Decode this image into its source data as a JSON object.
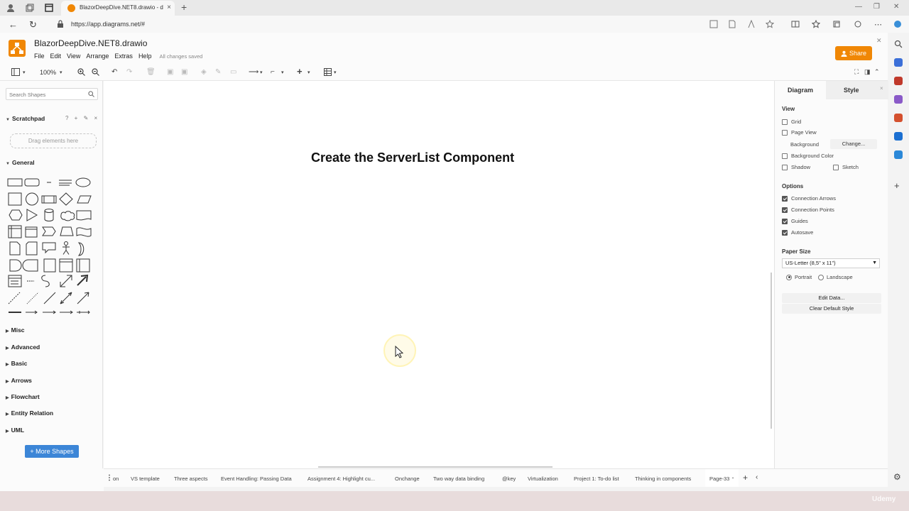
{
  "browser": {
    "tab_title": "BlazorDeepDive.NET8.drawio - d",
    "url": "https://app.diagrams.net/#",
    "new_tab": "+",
    "tab_close": "×"
  },
  "app": {
    "file_title": "BlazorDeepDive.NET8.drawio",
    "menu": [
      "File",
      "Edit",
      "View",
      "Arrange",
      "Extras",
      "Help"
    ],
    "save_status": "All changes saved",
    "share_label": "Share",
    "zoom": "100%"
  },
  "left_panel": {
    "search_placeholder": "Search Shapes",
    "scratchpad": "Scratchpad",
    "scratchpad_controls": "? + ✎ ×",
    "drop_hint": "Drag elements here",
    "general": "General",
    "categories": [
      "Misc",
      "Advanced",
      "Basic",
      "Arrows",
      "Flowchart",
      "Entity Relation",
      "UML"
    ],
    "more_shapes": "+ More Shapes"
  },
  "canvas": {
    "diagram_text": "Create the ServerList Component"
  },
  "right_panel": {
    "tab_diagram": "Diagram",
    "tab_style": "Style",
    "view_heading": "View",
    "grid": "Grid",
    "page_view": "Page View",
    "background": "Background",
    "change_btn": "Change...",
    "background_color": "Background Color",
    "shadow": "Shadow",
    "sketch": "Sketch",
    "options_heading": "Options",
    "connection_arrows": "Connection Arrows",
    "connection_points": "Connection Points",
    "guides": "Guides",
    "autosave": "Autosave",
    "paper_size_heading": "Paper Size",
    "paper_size_value": "US-Letter (8,5\" x 11\")",
    "portrait": "Portrait",
    "landscape": "Landscape",
    "edit_data": "Edit Data...",
    "clear_default_style": "Clear Default Style"
  },
  "pages": {
    "items": [
      "on",
      "VS template",
      "Three aspects",
      "Event Handling: Passing Data",
      "Assignment 4: Highlight cu...",
      "Onchange",
      "Two way data binding",
      "@key",
      "Virtualization",
      "Project 1: To-do list",
      "Thinking in components",
      "Page-33"
    ]
  },
  "overlay": {
    "udemy": "Udemy"
  },
  "colors": {
    "accent": "#f08705",
    "more_shapes_blue": "#3c86d7"
  }
}
